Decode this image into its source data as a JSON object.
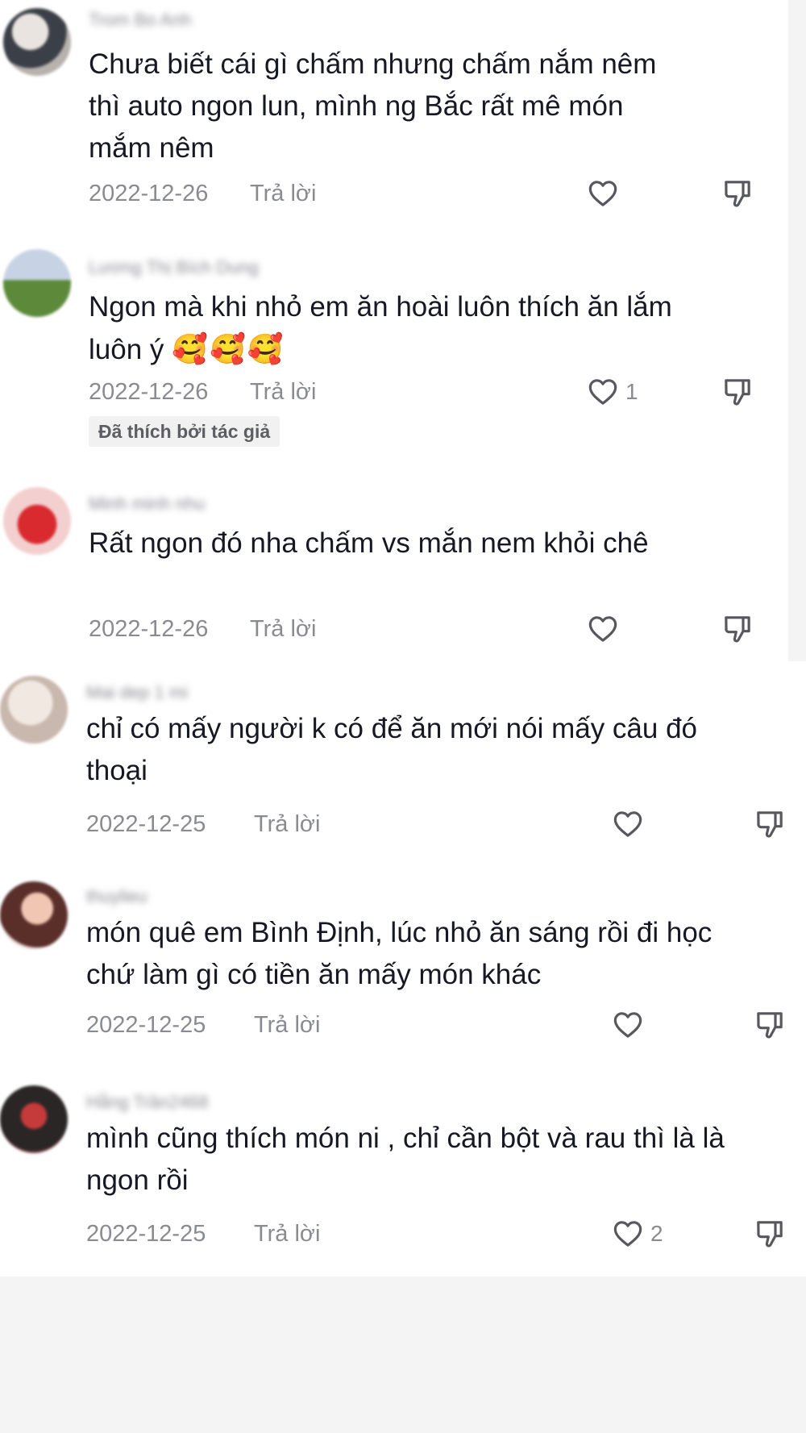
{
  "comments": [
    {
      "username": "Trom Bo Anh",
      "text": "Chưa biết cái gì chấm nhưng chấm nắm nêm thì auto ngon lun, mình ng Bắc rất mê món mắm nêm",
      "date": "2022-12-26",
      "reply_label": "Trả lời",
      "like_count": ""
    },
    {
      "username": "Lương Thị Bích Dung",
      "text": "Ngon mà khi nhỏ em ăn hoài luôn thích ăn lắm luôn ý",
      "emoji": "🥰🥰🥰",
      "date": "2022-12-26",
      "reply_label": "Trả lời",
      "like_count": "1",
      "badge": "Đã thích bởi tác giả"
    },
    {
      "username": "Minh minh nhu",
      "text": "Rất ngon đó nha chấm vs mắn nem khỏi chê",
      "date": "2022-12-26",
      "reply_label": "Trả lời",
      "like_count": ""
    },
    {
      "username": "Mai dep 1 mi",
      "text": "chỉ có mấy người k có để ăn mới nói mấy câu đó thoại",
      "date": "2022-12-25",
      "reply_label": "Trả lời",
      "like_count": ""
    },
    {
      "username": "thuylieu",
      "text": "món quê em Bình Định, lúc nhỏ ăn sáng rồi đi học chứ làm gì có tiền ăn mấy món khác",
      "date": "2022-12-25",
      "reply_label": "Trả lời",
      "like_count": ""
    },
    {
      "username": "Hằng Trần2468",
      "text": "mình cũng thích món ni , chỉ cần bột và rau thì là là ngon rồi",
      "date": "2022-12-25",
      "reply_label": "Trả lời",
      "like_count": "2"
    }
  ],
  "colors": {
    "text": "#161823",
    "secondary": "#8a8b91",
    "badge_bg": "#f1f1f2",
    "page_bg": "#f4f4f4"
  },
  "icons": [
    "heart-icon",
    "dislike-icon"
  ]
}
